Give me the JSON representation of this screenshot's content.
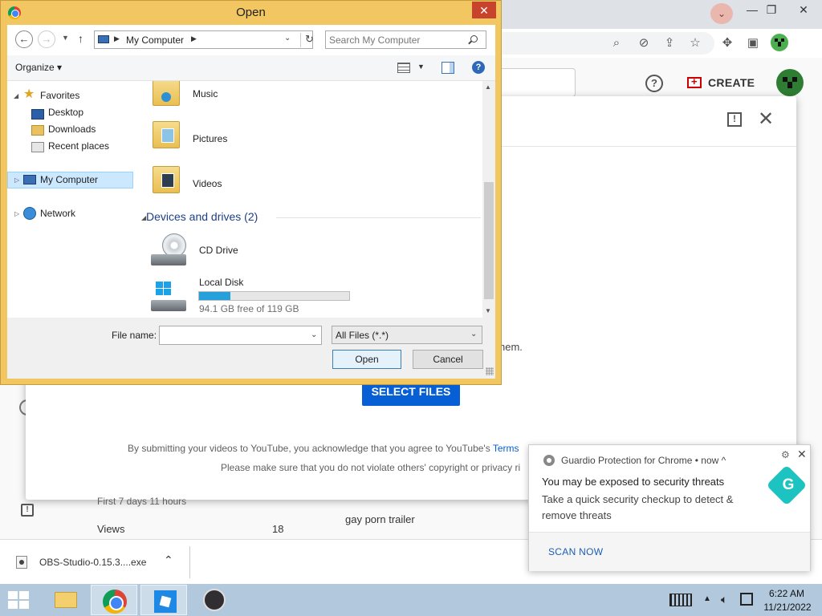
{
  "chrome": {
    "window_controls": {
      "minimize": "—",
      "restore": "❐",
      "close": "✕"
    },
    "profile_chevron": "⌄"
  },
  "youtube": {
    "help": "?",
    "create_label": "CREATE",
    "dialog": {
      "partial_text": "hem.",
      "select_files_label": "SELECT FILES",
      "terms_text": "By submitting your videos to YouTube, you acknowledge that you agree to YouTube's",
      "terms_link": "Terms",
      "copyright_text": "Please make sure that you do not violate others' copyright or privacy ri"
    },
    "stats": {
      "first_days": "First 7 days 11 hours",
      "views_label": "Views",
      "views_value": "18"
    },
    "right_list_item": "gay porn trailer"
  },
  "download_bar": {
    "file_name": "OBS-Studio-0.15.3....exe"
  },
  "guardio": {
    "source": "Guardio Protection for Chrome  •  now  ^",
    "title": "You may be exposed to security threats",
    "body": "Take a quick security checkup to detect & remove threats",
    "action": "SCAN NOW",
    "accent": "#1cc3c0"
  },
  "taskbar": {
    "apps": [
      "file-explorer",
      "google-chrome",
      "roblox",
      "obs-studio"
    ],
    "time": "6:22 AM",
    "date": "11/21/2022"
  },
  "open_dialog": {
    "title": "Open",
    "address": "My Computer",
    "search_placeholder": "Search My Computer",
    "organize_label": "Organize ▾",
    "nav_pane": {
      "favorites": "Favorites",
      "favorites_items": [
        "Desktop",
        "Downloads",
        "Recent places"
      ],
      "my_computer": "My Computer",
      "network": "Network"
    },
    "folders": [
      "Music",
      "Pictures",
      "Videos"
    ],
    "devices_header": "Devices and drives (2)",
    "drives": {
      "cd": "CD Drive",
      "local_disk": "Local Disk",
      "local_disk_free": "94.1 GB free of 119 GB",
      "local_disk_used_fraction": 0.21
    },
    "file_name_label": "File name:",
    "file_name_value": "",
    "file_type": "All Files (*.*)",
    "open_label": "Open",
    "cancel_label": "Cancel"
  }
}
